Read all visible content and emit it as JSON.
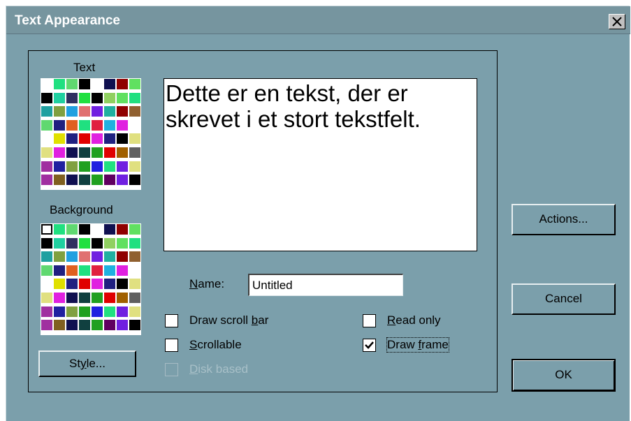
{
  "window": {
    "title": "Text Appearance",
    "close_symbol": "×"
  },
  "palettes": {
    "text_label": "Text",
    "background_label": "Background",
    "colors": [
      [
        "#ffffff",
        "#20e080",
        "#60d870",
        "#000000",
        "#ffffff",
        "#101050",
        "#900000",
        "#60e060"
      ],
      [
        "#000000",
        "#20d0a0",
        "#303060",
        "#20e040",
        "#000000",
        "#90d060",
        "#60e060",
        "#20e080"
      ],
      [
        "#20a0a0",
        "#80a040",
        "#20a0e0",
        "#e07070",
        "#7020e0",
        "#20b0a0",
        "#900000",
        "#906030"
      ],
      [
        "#60d870",
        "#202080",
        "#e06020",
        "#20e080",
        "#e02040",
        "#20b0e0",
        "#e020e0",
        "#ffffff"
      ],
      [
        "#ffffff",
        "#e0e000",
        "#202080",
        "#e00000",
        "#e020e0",
        "#202080",
        "#000000",
        "#e0e080"
      ],
      [
        "#e0e080",
        "#e020e0",
        "#101050",
        "#104040",
        "#20a020",
        "#e00000",
        "#a06000",
        "#606060"
      ],
      [
        "#a030a0",
        "#2020a0",
        "#80a040",
        "#20a020",
        "#2020e0",
        "#20e080",
        "#7020e0",
        "#e0e080"
      ],
      [
        "#a030a0",
        "#806020",
        "#101050",
        "#104040",
        "#20a020",
        "#600060",
        "#7020e0",
        "#000000"
      ]
    ]
  },
  "preview": {
    "text": "Dette er en tekst, der er skrevet i et stort tekstfelt."
  },
  "name_field": {
    "label": "Name:",
    "value": "Untitled"
  },
  "checkboxes": {
    "draw_scroll_bar": {
      "label": "Draw scroll bar",
      "checked": false,
      "enabled": true
    },
    "scrollable": {
      "label": "Scrollable",
      "checked": false,
      "enabled": true
    },
    "disk_based": {
      "label": "Disk based",
      "checked": false,
      "enabled": false
    },
    "read_only": {
      "label": "Read only",
      "checked": false,
      "enabled": true
    },
    "draw_frame": {
      "label": "Draw frame",
      "checked": true,
      "enabled": true
    }
  },
  "buttons": {
    "style": "Style...",
    "actions": "Actions...",
    "cancel": "Cancel",
    "ok": "OK"
  },
  "colors": {
    "dialog_bg": "#7b9fab",
    "titlebar": "#76959f"
  }
}
